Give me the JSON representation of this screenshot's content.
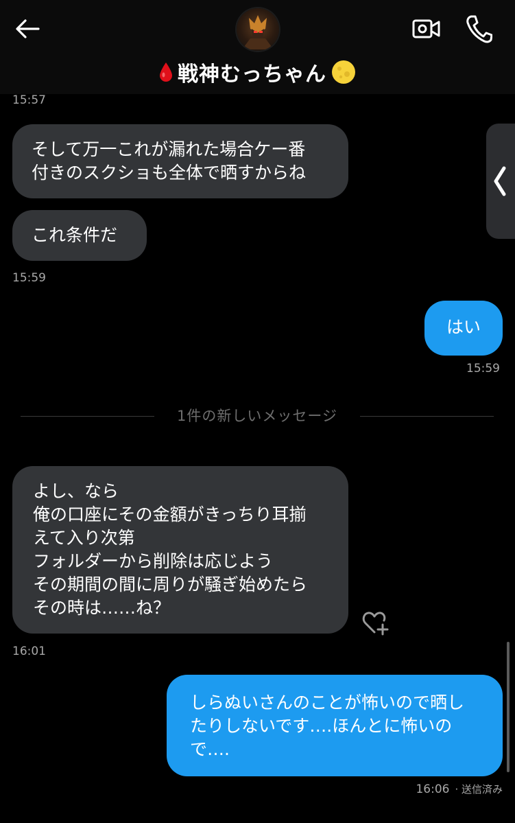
{
  "header": {
    "title": "戦神むっちゃん",
    "icons": [
      "back-arrow-icon",
      "avatar",
      "blood-drop-icon",
      "moon-icon",
      "video-camera-icon",
      "phone-icon"
    ]
  },
  "messages": {
    "time_top": "15:57",
    "m1": "そして万一これが漏れた場合ケー番\n付きのスクショも全体で晒すからね",
    "m2": "これ条件だ",
    "time_m2": "15:59",
    "m3": "はい",
    "time_m3": "15:59",
    "divider": "1件の新しいメッセージ",
    "m4": "よし、なら\n俺の口座にその金額がきっちり耳揃\nえて入り次第\nフォルダーから削除は応じよう\nその期間の間に周りが騒ぎ始めたら\nその時は……ね？",
    "time_m4": "16:01",
    "m5": "しらぬいさんのことが怖いので晒し\nたりしないです….ほんとに怖いの\nで….",
    "time_m5": "16:06",
    "status_m5": "· 送信済み"
  },
  "colors": {
    "background": "#000000",
    "incoming_bubble": "#333538",
    "outgoing_bubble": "#1d9bf0",
    "timestamp": "#a8a8a8"
  }
}
